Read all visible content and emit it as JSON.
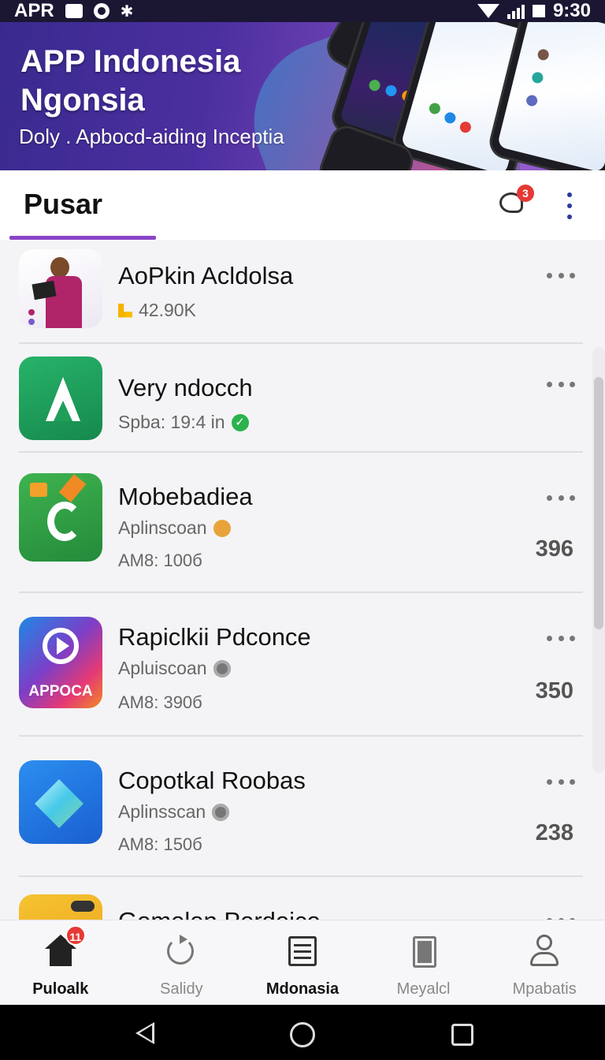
{
  "status_bar": {
    "left_text": "APR",
    "time": "9:30"
  },
  "banner": {
    "title_line1": "APP Indonesia",
    "title_line2": "Ngonsia",
    "subtitle": "Doly . Apbocd-aiding Inceptia"
  },
  "header": {
    "title": "Pusar",
    "notification_count": "3"
  },
  "apps": [
    {
      "name": "AoPkin Acldolsa",
      "sub": "42.90K",
      "meta": "",
      "count": ""
    },
    {
      "name": "Very ndocch",
      "sub": "Spba: 19:4 in",
      "meta": "",
      "count": ""
    },
    {
      "name": "Mobebadiea",
      "sub": "Aplinscoan",
      "meta": "AM8: 100б",
      "count": "396"
    },
    {
      "name": "Rapiclkii Pdconce",
      "sub": "Apluiscoan",
      "meta": "AM8: 390б",
      "count": "350",
      "icon_text": "APPOCA"
    },
    {
      "name": "Copotkal Roobas",
      "sub": "Aplinsscan",
      "meta": "AM8: 150б",
      "count": "238"
    },
    {
      "name": "Gemelen Perdeice",
      "sub": "",
      "meta": "",
      "count": ""
    }
  ],
  "bottom_nav": [
    {
      "label": "Puloalk",
      "icon": "home-icon",
      "badge": "11"
    },
    {
      "label": "Salidy",
      "icon": "refresh-icon"
    },
    {
      "label": "Mdonasia",
      "icon": "document-icon"
    },
    {
      "label": "Meyalcl",
      "icon": "clipboard-icon"
    },
    {
      "label": "Mpabatis",
      "icon": "profile-icon"
    }
  ],
  "colors": {
    "accent": "#8a44c8",
    "badge": "#e53935",
    "banner_start": "#3a2a8e"
  }
}
